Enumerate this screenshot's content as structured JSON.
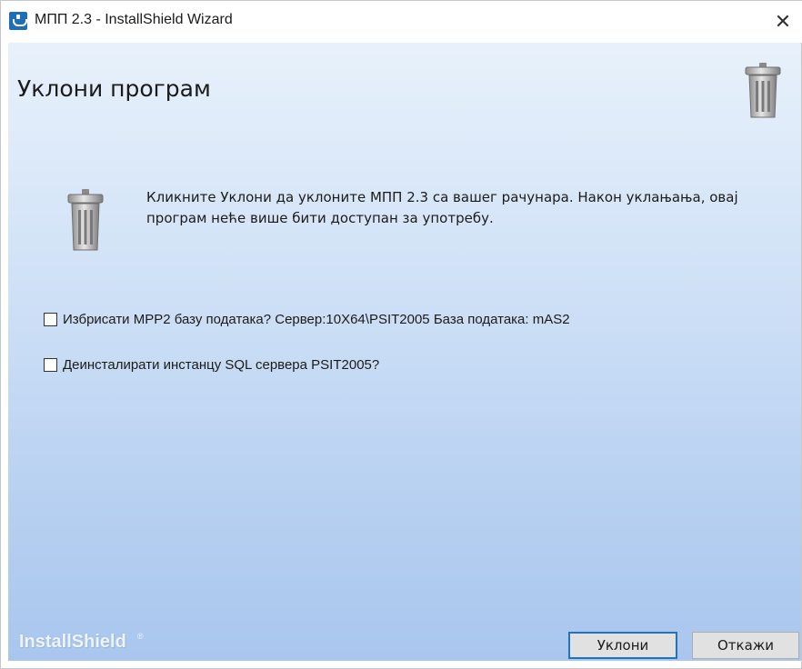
{
  "window": {
    "title": "МПП 2.3 - InstallShield Wizard",
    "close_glyph": "✕"
  },
  "page": {
    "title": "Уклони програм",
    "description": "Кликните Уклони да уклоните МПП 2.3 са вашег рачунара. Након уклањања, овај програм неће више бити доступан за употребу."
  },
  "options": [
    {
      "label": "Избрисати MPP2 базу података? Сервер:10X64\\PSIT2005 База података: mAS2",
      "checked": false
    },
    {
      "label": "Деинсталирати инстанцу SQL сервера PSIT2005?",
      "checked": false
    }
  ],
  "footer": {
    "brand": "InstallShield",
    "brand_mark": "®",
    "remove_label": "Уклони",
    "cancel_label": "Откажи"
  },
  "icons": {
    "app": "installshield-app-icon",
    "trash": "trash-bin-icon"
  },
  "colors": {
    "accent": "#1f73c7",
    "gradient_top": "#e8f1fb",
    "gradient_bottom": "#a9c6ee"
  }
}
